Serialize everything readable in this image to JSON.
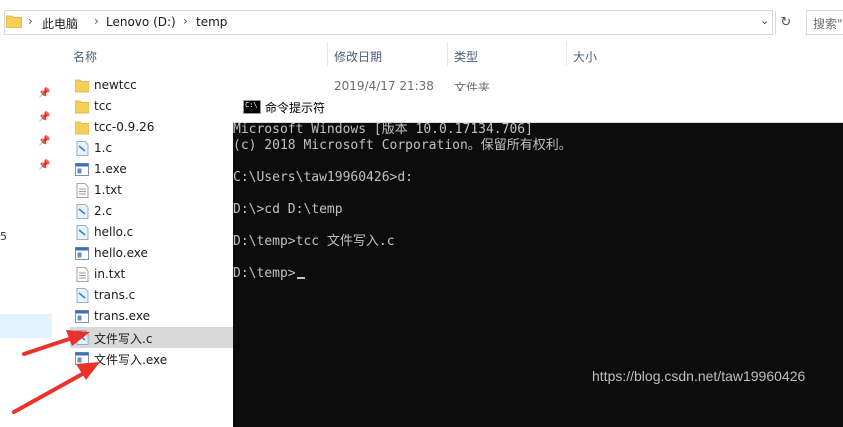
{
  "address_bar": {
    "crumbs": [
      "此电脑",
      "Lenovo (D:)",
      "temp"
    ],
    "search_placeholder": "搜索\""
  },
  "columns": {
    "name": "名称",
    "modified": "修改日期",
    "type": "类型",
    "size": "大小"
  },
  "first_row_meta": {
    "modified": "2019/4/17 21:38",
    "type": "文件夹"
  },
  "nav_edge_text": "5",
  "files": [
    {
      "name": "newtcc",
      "icon": "folder-icon"
    },
    {
      "name": "tcc",
      "icon": "folder-icon"
    },
    {
      "name": "tcc-0.9.26",
      "icon": "folder-icon"
    },
    {
      "name": "1.c",
      "icon": "c-file-icon"
    },
    {
      "name": "1.exe",
      "icon": "exe-file-icon"
    },
    {
      "name": "1.txt",
      "icon": "txt-file-icon"
    },
    {
      "name": "2.c",
      "icon": "c-file-icon"
    },
    {
      "name": "hello.c",
      "icon": "c-file-icon"
    },
    {
      "name": "hello.exe",
      "icon": "exe-file-icon"
    },
    {
      "name": "in.txt",
      "icon": "txt-file-icon"
    },
    {
      "name": "trans.c",
      "icon": "c-file-icon"
    },
    {
      "name": "trans.exe",
      "icon": "exe-file-icon"
    },
    {
      "name": "文件写入.c",
      "icon": "c-file-icon",
      "selected": true
    },
    {
      "name": "文件写入.exe",
      "icon": "exe-file-icon"
    }
  ],
  "cmd": {
    "title": "命令提示符",
    "icon_text": "C:\\",
    "lines": [
      "Microsoft Windows [版本 10.0.17134.706]",
      "(c) 2018 Microsoft Corporation。保留所有权利。",
      "",
      "C:\\Users\\taw19960426>d:",
      "",
      "D:\\>cd D:\\temp",
      "",
      "D:\\temp>tcc 文件写入.c",
      "",
      "D:\\temp>"
    ]
  },
  "watermark": "https://blog.csdn.net/taw19960426",
  "colors": {
    "arrow": "#e8322a",
    "terminal_bg": "#0c0c0c",
    "terminal_fg": "#c0c0c0",
    "selection": "#d9d9d9",
    "folder": "#f6cf5a"
  }
}
